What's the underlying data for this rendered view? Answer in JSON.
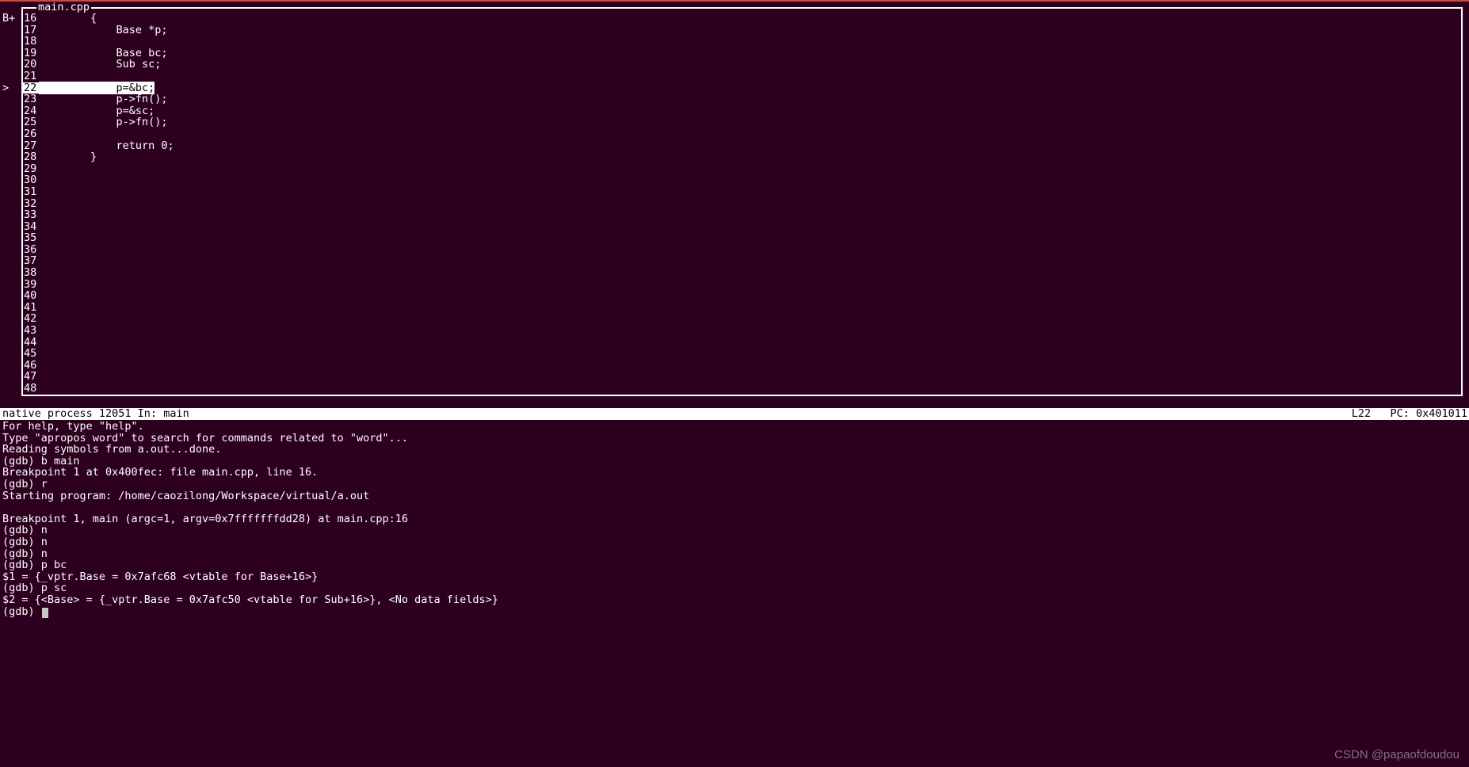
{
  "file_name": "main.cpp",
  "gutter_marks": {
    "bplus": "B+",
    "caret": ">"
  },
  "source": {
    "highlight_line": 22,
    "lines": [
      {
        "n": 16,
        "t": "        {"
      },
      {
        "n": 17,
        "t": "            Base *p;"
      },
      {
        "n": 18,
        "t": ""
      },
      {
        "n": 19,
        "t": "            Base bc;"
      },
      {
        "n": 20,
        "t": "            Sub sc;"
      },
      {
        "n": 21,
        "t": ""
      },
      {
        "n": 22,
        "t": "            p=&bc;"
      },
      {
        "n": 23,
        "t": "            p->fn();"
      },
      {
        "n": 24,
        "t": "            p=&sc;"
      },
      {
        "n": 25,
        "t": "            p->fn();"
      },
      {
        "n": 26,
        "t": ""
      },
      {
        "n": 27,
        "t": "            return 0;"
      },
      {
        "n": 28,
        "t": "        }"
      },
      {
        "n": 29,
        "t": ""
      },
      {
        "n": 30,
        "t": ""
      },
      {
        "n": 31,
        "t": ""
      },
      {
        "n": 32,
        "t": ""
      },
      {
        "n": 33,
        "t": ""
      },
      {
        "n": 34,
        "t": ""
      },
      {
        "n": 35,
        "t": ""
      },
      {
        "n": 36,
        "t": ""
      },
      {
        "n": 37,
        "t": ""
      },
      {
        "n": 38,
        "t": ""
      },
      {
        "n": 39,
        "t": ""
      },
      {
        "n": 40,
        "t": ""
      },
      {
        "n": 41,
        "t": ""
      },
      {
        "n": 42,
        "t": ""
      },
      {
        "n": 43,
        "t": ""
      },
      {
        "n": 44,
        "t": ""
      },
      {
        "n": 45,
        "t": ""
      },
      {
        "n": 46,
        "t": ""
      },
      {
        "n": 47,
        "t": ""
      },
      {
        "n": 48,
        "t": ""
      }
    ]
  },
  "status_bar": {
    "left": "native process 12051 In: main",
    "right": "L22   PC: 0x401011"
  },
  "console": [
    "For help, type \"help\".",
    "Type \"apropos word\" to search for commands related to \"word\"...",
    "Reading symbols from a.out...done.",
    "(gdb) b main",
    "Breakpoint 1 at 0x400fec: file main.cpp, line 16.",
    "(gdb) r",
    "Starting program: /home/caozilong/Workspace/virtual/a.out",
    "",
    "Breakpoint 1, main (argc=1, argv=0x7fffffffdd28) at main.cpp:16",
    "(gdb) n",
    "(gdb) n",
    "(gdb) n",
    "(gdb) p bc",
    "$1 = {_vptr.Base = 0x7afc68 <vtable for Base+16>}",
    "(gdb) p sc",
    "$2 = {<Base> = {_vptr.Base = 0x7afc50 <vtable for Sub+16>}, <No data fields>}",
    "(gdb) "
  ],
  "watermark": "CSDN @papaofdoudou"
}
